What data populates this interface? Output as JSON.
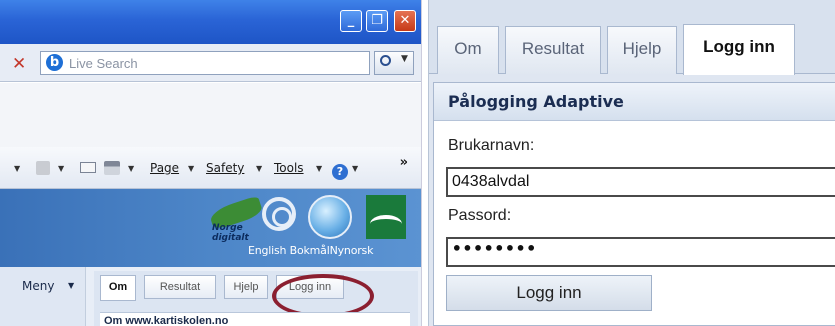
{
  "browser": {
    "search": {
      "placeholder": "Live Search"
    },
    "command_bar": {
      "page": "Page",
      "safety": "Safety",
      "tools": "Tools",
      "more": "»"
    }
  },
  "site_left": {
    "banner": {
      "logo_text": "Norge digitalt",
      "lang_labels": [
        "English",
        "Bokmål",
        "Nynorsk"
      ]
    },
    "menu_label": "Meny",
    "tabs": [
      "Om",
      "Resultat",
      "Hjelp",
      "Logg inn"
    ],
    "active_tab_index": 0,
    "subheading": "Om www.kartiskolen.no"
  },
  "login": {
    "tabs": [
      "Om",
      "Resultat",
      "Hjelp",
      "Logg inn"
    ],
    "active_tab_index": 3,
    "panel_title": "Pålogging Adaptive",
    "username_label": "Brukarnavn:",
    "username_value": "0438alvdal",
    "password_label": "Passord:",
    "password_value": "••••••••",
    "submit_label": "Logg inn"
  },
  "colors": {
    "titlebar": "#2a64d6",
    "highlight_ring": "#8b1f30",
    "panel_header": "#d5e0ee"
  }
}
